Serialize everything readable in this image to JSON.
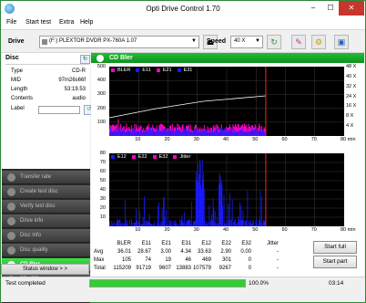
{
  "window": {
    "title": "Opti Drive Control 1.70",
    "min": "–",
    "max": "☐",
    "close": "✕"
  },
  "menu": [
    "File",
    "Start test",
    "Extra",
    "Help"
  ],
  "toolbar": {
    "drive_label": "Drive",
    "drive_value": "(F:)   PLEXTOR DVDR   PX-760A 1.07",
    "speed_label": "Speed",
    "speed_value": "40 X"
  },
  "disc": {
    "header": "Disc",
    "rows": [
      {
        "label": "Type",
        "value": "CD-R"
      },
      {
        "label": "MID",
        "value": "97m26s66f"
      },
      {
        "label": "Length",
        "value": "53:19.53"
      },
      {
        "label": "Contents",
        "value": "audio"
      }
    ],
    "label_label": "Label"
  },
  "nav": [
    {
      "label": "Transfer rate",
      "active": false
    },
    {
      "label": "Create test disc",
      "active": false
    },
    {
      "label": "Verify test disc",
      "active": false
    },
    {
      "label": "Drive info",
      "active": false
    },
    {
      "label": "Disc info",
      "active": false
    },
    {
      "label": "Disc quality",
      "active": false
    },
    {
      "label": "CD Bler",
      "active": true
    },
    {
      "label": "FE / TE",
      "active": false
    },
    {
      "label": "Extra tests",
      "active": false
    }
  ],
  "status_window_label": "Status window > >",
  "graph_header": "CD Bler",
  "chart_data": [
    {
      "type": "area",
      "series": [
        {
          "name": "BLER",
          "color": "#ff00cc"
        },
        {
          "name": "E11",
          "color": "#1a1aff"
        },
        {
          "name": "E21",
          "color": "#ff00cc"
        },
        {
          "name": "E31",
          "color": "#1a1aff"
        }
      ],
      "speed_line_color": "#ffffff",
      "end_marker_x": 53.3,
      "xlim": [
        0,
        80
      ],
      "x_ticks": [
        "10",
        "20",
        "30",
        "40",
        "50",
        "60",
        "70",
        "80 min"
      ],
      "ylim": [
        0,
        500
      ],
      "y_ticks": [
        "100",
        "200",
        "300",
        "400",
        "500"
      ],
      "y2_ticks": [
        "4 X",
        "8 X",
        "16 X",
        "24 X",
        "32 X",
        "40 X",
        "48 X"
      ]
    },
    {
      "type": "area",
      "series": [
        {
          "name": "E12",
          "color": "#1a1aff"
        },
        {
          "name": "E22",
          "color": "#ff00cc"
        },
        {
          "name": "E32",
          "color": "#ff00cc"
        },
        {
          "name": "Jitter",
          "color": "#ff00cc"
        }
      ],
      "end_marker_x": 53.3,
      "xlim": [
        0,
        80
      ],
      "x_ticks": [
        "10",
        "20",
        "30",
        "40",
        "50",
        "60",
        "70",
        "80 min"
      ],
      "ylim": [
        0,
        80
      ],
      "y_ticks": [
        "10",
        "20",
        "30",
        "40",
        "50",
        "60",
        "70",
        "80"
      ]
    }
  ],
  "stats": {
    "columns": [
      "BLER",
      "E11",
      "E21",
      "E31",
      "E12",
      "E22",
      "E32",
      "Jitter"
    ],
    "rows": [
      {
        "label": "Avg",
        "values": [
          "36.01",
          "28.67",
          "3.00",
          "4.34",
          "33.63",
          "2.90",
          "0.00",
          "-"
        ]
      },
      {
        "label": "Max",
        "values": [
          "105",
          "74",
          "19",
          "46",
          "469",
          "301",
          "0",
          "-"
        ]
      },
      {
        "label": "Total",
        "values": [
          "115209",
          "91719",
          "9607",
          "13883",
          "107579",
          "9267",
          "0",
          "-"
        ]
      }
    ]
  },
  "buttons": {
    "start_full": "Start full",
    "start_part": "Start part"
  },
  "status": {
    "text": "Test completed",
    "progress": 1.0,
    "percent": "100.0%",
    "elapsed": "03:14"
  }
}
